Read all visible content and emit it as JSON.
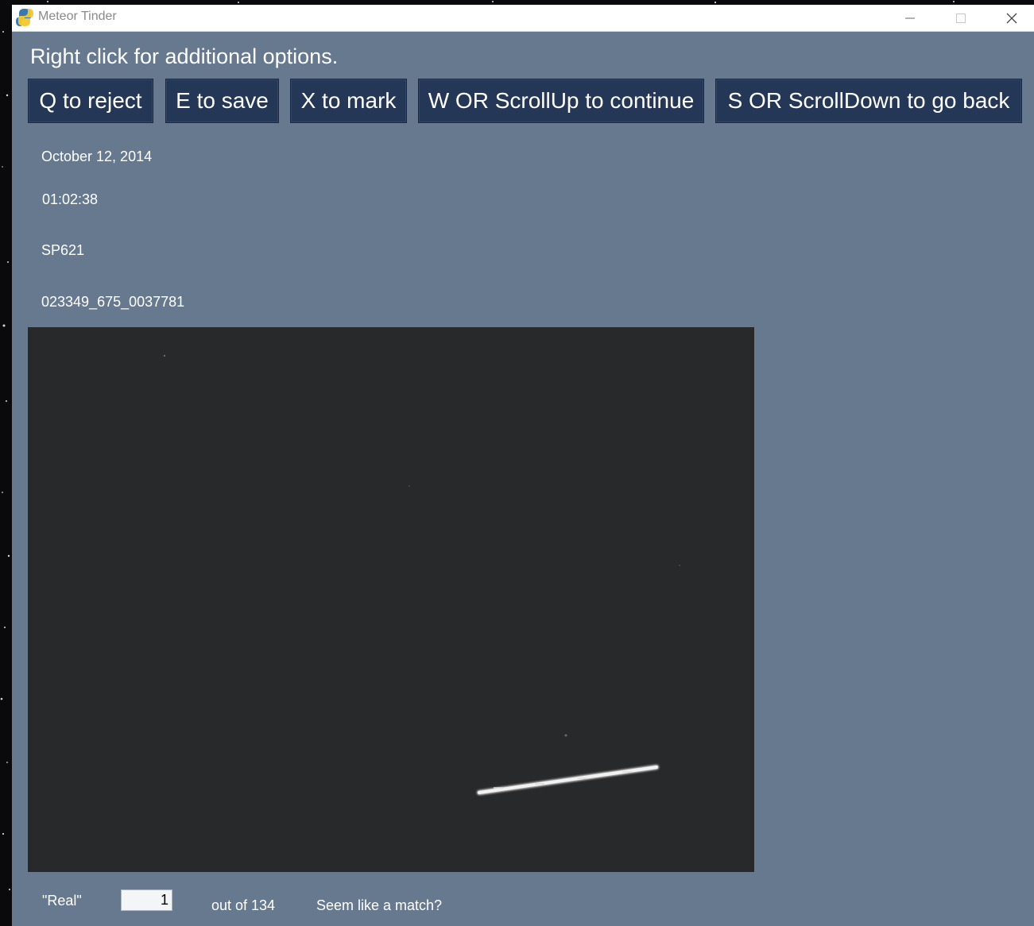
{
  "window": {
    "title": "Meteor Tinder",
    "controls": {
      "minimize": "minimize-icon",
      "maximize": "maximize-icon",
      "close": "close-icon"
    }
  },
  "hint_text": "Right click for additional options.",
  "actions": [
    {
      "id": "reject",
      "label": "Q to reject"
    },
    {
      "id": "save",
      "label": "E to save"
    },
    {
      "id": "mark",
      "label": "X to mark"
    },
    {
      "id": "continue",
      "label": "W OR ScrollUp to continue"
    },
    {
      "id": "back",
      "label": "S OR ScrollDown to go back"
    }
  ],
  "info": {
    "date": "October 12, 2014",
    "time": "01:02:38",
    "station": "SP621",
    "file_id": "023349_675_0037781"
  },
  "image": {
    "description_icon": "meteor-trail-image"
  },
  "footer": {
    "real_label": "\"Real\"",
    "current_value": "1",
    "out_of": "out of 134",
    "question": "Seem like a match?"
  },
  "colors": {
    "window_bg": "#66798f",
    "button_bg": "#253756",
    "image_bg": "#262728"
  }
}
